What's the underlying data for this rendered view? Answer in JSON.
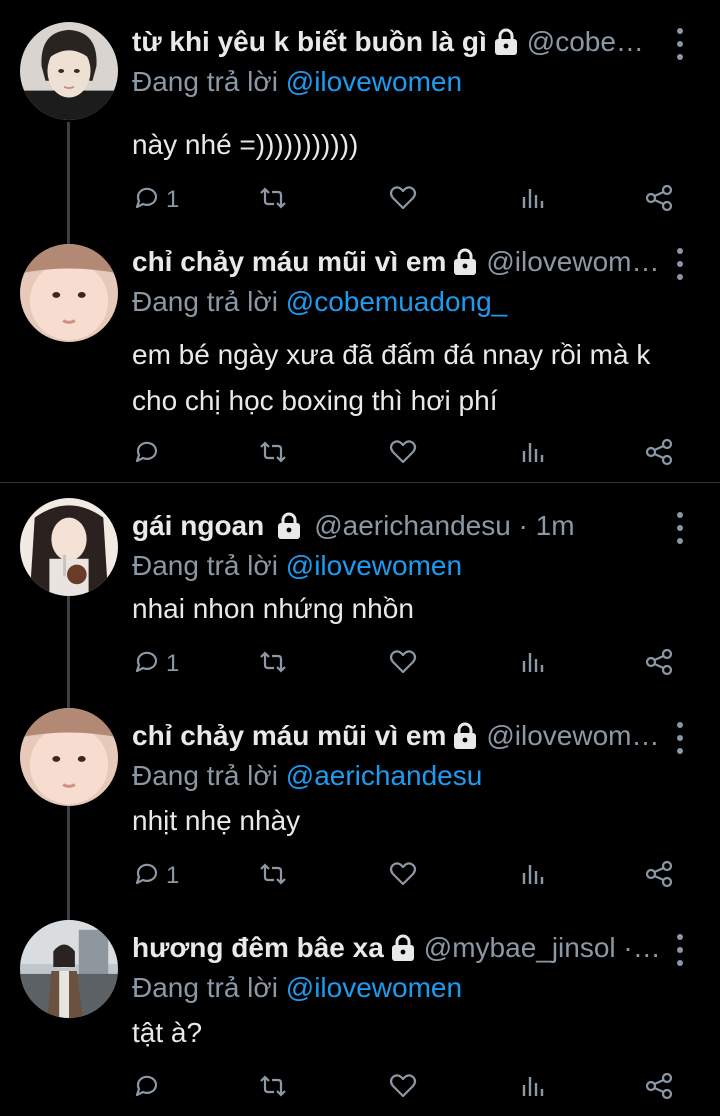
{
  "reply_prefix": "Đang trả lời",
  "tweets": [
    {
      "name": "từ khi yêu k biết buồn là gì",
      "handle": "@cobem...",
      "reply_to": "@ilovewomen",
      "text": "này nhé =)))))))))))",
      "reply_count": "1"
    },
    {
      "name": "chỉ chảy máu mũi vì em",
      "handle": "@ilovewome...",
      "reply_to": "@cobemuadong_",
      "text": "em bé ngày xưa đã đấm đá nnay rồi mà k cho chị học boxing thì hơi phí",
      "reply_count": ""
    },
    {
      "name": "gái ngoan",
      "handle": "@aerichandesu · 1m",
      "reply_to": "@ilovewomen",
      "text": "nhai nhon nhứng nhồn",
      "reply_count": "1"
    },
    {
      "name": "chỉ chảy máu mũi vì em",
      "handle": "@ilovewome...",
      "reply_to": "@aerichandesu",
      "text": "nhịt nhẹ nhày",
      "reply_count": "1"
    },
    {
      "name": "hương đêm bâe xa",
      "handle": "@mybae_jinsol · 1...",
      "reply_to": "@ilovewomen",
      "text": "tật à?",
      "reply_count": ""
    }
  ],
  "icons": {
    "reply": "comment-icon",
    "retweet": "retweet-icon",
    "like": "heart-icon",
    "views": "analytics-icon",
    "share": "share-icon",
    "lock": "lock-icon",
    "more": "more-vertical-icon"
  },
  "colors": {
    "background": "#000000",
    "text": "#e7e9ea",
    "muted": "#8b98a5",
    "mention": "#1d9bf0",
    "thread_line": "#3a3f44"
  }
}
